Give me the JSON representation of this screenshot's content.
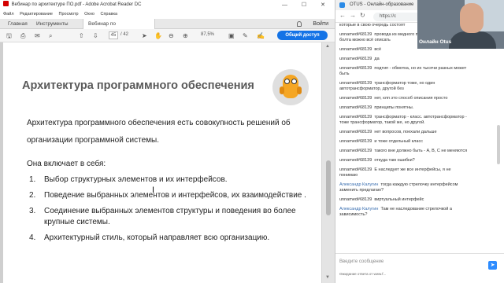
{
  "acrobat": {
    "window_title": "Вебинар по архитектуре ПО.pdf - Adobe Acrobat Reader DC",
    "window_controls": "— ☐ ✕",
    "menu": [
      "Файл",
      "Редактирование",
      "Просмотр",
      "Окно",
      "Справка"
    ],
    "tabs": [
      "Главная",
      "Инструменты",
      "Вебинар по архитект..."
    ],
    "tab_close": "×",
    "signin": "Войти",
    "page_current": "45",
    "page_total": "/ 42",
    "zoom": "87,5%",
    "share_label": "Общий доступ"
  },
  "slide": {
    "title": "Архитектура программного обеспечения",
    "intro": "Архитектура программного обеспечения есть совокупность решений об организации программной системы.",
    "contains": "Она включает в себя:",
    "items": [
      "Выбор структурных элементов и их интерфейсов.",
      "Поведение выбранных элементов и интерфейсов, их взаимодействие .",
      "Соединение выбранных элементов структуры и поведения во  более крупные системы.",
      "Архитектурный стиль, который направляет всю организацию."
    ]
  },
  "chat": {
    "window_title": "OTUS - Онлайн-образование",
    "url": "https://c",
    "messages": [
      {
        "user": "",
        "text": "которые в свою очередь состоят"
      },
      {
        "user": "unnamed#68139",
        "text": "провода из медного проводника, сердечник, болта можно всё описать"
      },
      {
        "user": "unnamed#68139",
        "text": "всё"
      },
      {
        "user": "unnamed#68139",
        "text": "да"
      },
      {
        "user": "unnamed#68139",
        "text": "подтип - обмотка, но их тысячи разных может быть"
      },
      {
        "user": "unnamed#68139",
        "text": "трансформатор тоже, но один автотрансформатор, другой без"
      },
      {
        "user": "unnamed#68139",
        "text": "нет, клп это способ описания просто"
      },
      {
        "user": "unnamed#68139",
        "text": "принципы понятны."
      },
      {
        "user": "unnamed#68139",
        "text": "трансформатор - класс. автотрансформатор - тоже трансформатор, такой же, но другой."
      },
      {
        "user": "unnamed#68139",
        "text": "нет вопросов, поехали дальше"
      },
      {
        "user": "unnamed#68139",
        "text": "и тоже отдельный класс"
      },
      {
        "user": "unnamed#68139",
        "text": "такого вне должно быть - А, В, С не меняются"
      },
      {
        "user": "unnamed#68139",
        "text": "откуда там ошибки?"
      },
      {
        "user": "unnamed#68139",
        "text": "Е наследует же все интерфейсы, я не понимаю"
      },
      {
        "user": "Александр Калугин",
        "text": "тогда каждую стрелочку интерфейсом заменить предлагаю?"
      },
      {
        "user": "unnamed#68139",
        "text": "виртуальный интерфейс"
      },
      {
        "user": "Александр Калугин",
        "text": "Там не наследование стрелочкой а зависимость?"
      }
    ],
    "input_placeholder": "Введите сообщение",
    "send_icon": "➤",
    "footer_note": "Ожидание ответа от www.f..."
  },
  "zoom": {
    "speaker_name": "Онлайн Otus",
    "logo": "zoom"
  }
}
